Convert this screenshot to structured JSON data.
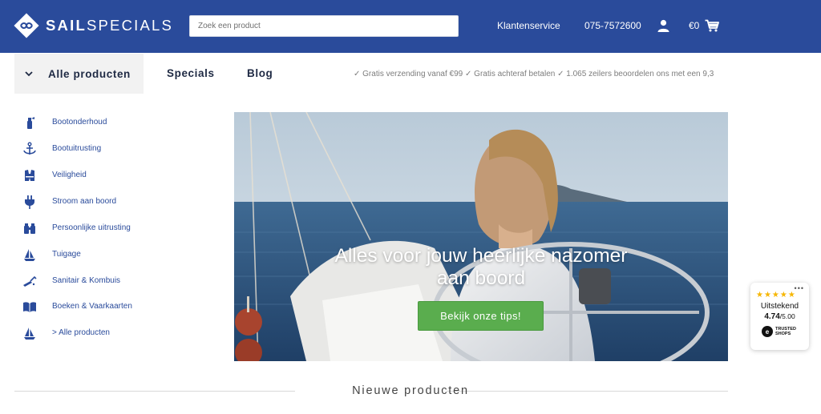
{
  "header": {
    "logo_bold": "SAIL",
    "logo_light": "SPECIALS",
    "search_placeholder": "Zoek een product",
    "service_label": "Klantenservice",
    "phone": "075-7572600",
    "cart_amount": "€0",
    "icons": {
      "logo": "sailspecials-logo-icon",
      "user": "user-icon",
      "cart": "cart-icon"
    },
    "colors": {
      "bar": "#2a4b9b",
      "text": "#ffffff"
    }
  },
  "nav": {
    "all_products": "Alle producten",
    "specials": "Specials",
    "blog": "Blog",
    "usp": "✓ Gratis verzending vanaf €99 ✓ Gratis achteraf betalen ✓ 1.065 zeilers beoordelen ons met een 9,3"
  },
  "sidebar": {
    "items": [
      {
        "label": "Bootonderhoud",
        "icon": "spray-bottle-icon"
      },
      {
        "label": "Bootuitrusting",
        "icon": "anchor-icon"
      },
      {
        "label": "Veiligheid",
        "icon": "life-vest-icon"
      },
      {
        "label": "Stroom aan boord",
        "icon": "plug-icon"
      },
      {
        "label": "Persoonlijke uitrusting",
        "icon": "binoculars-icon"
      },
      {
        "label": "Tuigage",
        "icon": "sailboat-icon"
      },
      {
        "label": "Sanitair & Kombuis",
        "icon": "faucet-icon"
      },
      {
        "label": "Boeken & Vaarkaarten",
        "icon": "book-icon"
      },
      {
        "label": "> Alle producten",
        "icon": "sailboat-icon"
      }
    ],
    "icon_color": "#2a4b9b"
  },
  "hero": {
    "title_line1": "Alles voor jouw heerlijke nazomer",
    "title_line2": "aan boord",
    "cta": "Bekijk onze tips!",
    "cta_color": "#5aad4e"
  },
  "trust": {
    "rating_word": "Uitstekend",
    "score": "4.74",
    "max": "/5.00",
    "brand_line1": "TRUSTED",
    "brand_line2": "SHOPS",
    "stars": "★★★★★",
    "more": "•••"
  },
  "section": {
    "title": "Nieuwe producten"
  }
}
